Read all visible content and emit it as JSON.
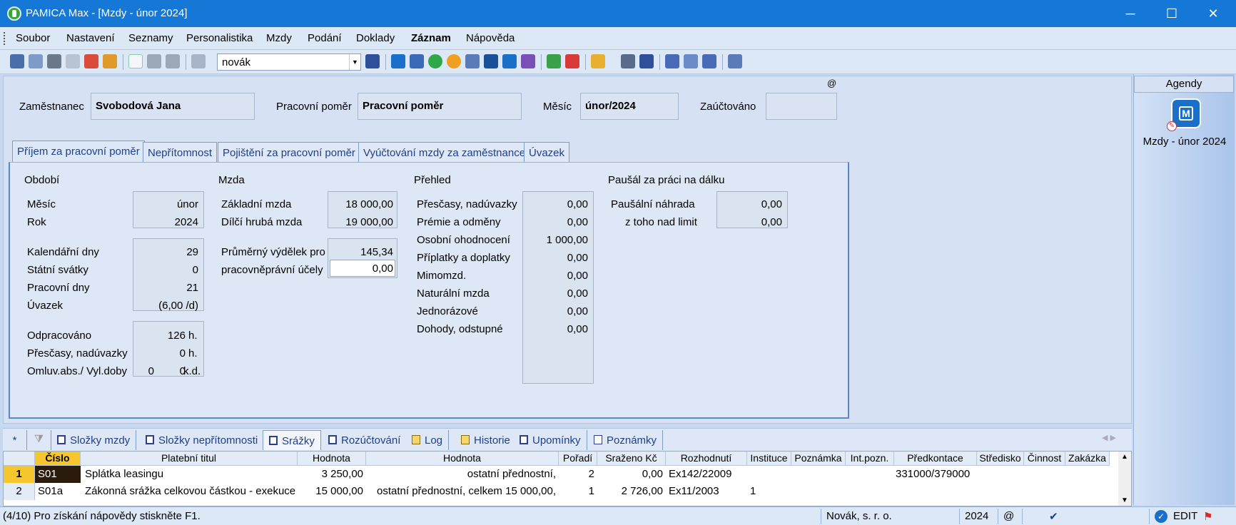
{
  "window": {
    "title": "PAMICA Max - [Mzdy - únor 2024]",
    "minimize": "─",
    "maximize": "☐",
    "close": "✕"
  },
  "menu": [
    {
      "label": "Soubor",
      "bold": false
    },
    {
      "label": "Nastavení",
      "bold": false
    },
    {
      "label": "Seznamy",
      "bold": false
    },
    {
      "label": "Personalistika",
      "bold": false
    },
    {
      "label": "Mzdy",
      "bold": false
    },
    {
      "label": "Podání",
      "bold": false
    },
    {
      "label": "Doklady",
      "bold": false
    },
    {
      "label": "Záznam",
      "bold": true
    },
    {
      "label": "Nápověda",
      "bold": false
    }
  ],
  "toolbar": {
    "search_value": "novák"
  },
  "header": {
    "at_label": "@",
    "employee_label": "Zaměstnanec",
    "employee_value": "Svobodová Jana",
    "relation_label": "Pracovní poměr",
    "relation_value": "Pracovní poměr",
    "month_label": "Měsíc",
    "month_value": "únor/2024",
    "posted_label": "Zaúčtováno",
    "posted_value": ""
  },
  "tabs": [
    "Příjem za pracovní poměr",
    "Nepřítomnost",
    "Pojištění za pracovní poměr",
    "Vyúčtování mzdy za zaměstnance",
    "Úvazek"
  ],
  "period": {
    "title": "Období",
    "month_label": "Měsíc",
    "month": "únor",
    "year_label": "Rok",
    "year": "2024",
    "cal_days_label": "Kalendářní dny",
    "cal_days": "29",
    "holidays_label": "Státní svátky",
    "holidays": "0",
    "work_days_label": "Pracovní dny",
    "work_days": "21",
    "workload_label": "Úvazek",
    "workload": "(6,00 /d)",
    "worked_label": "Odpracováno",
    "worked": "126",
    "worked_unit": "h.",
    "overtime_label": "Přesčasy, nadúvazky",
    "overtime": "0",
    "overtime_unit": "h.",
    "absence_label": "Omluv.abs./ Vyl.doby",
    "absence_a": "0",
    "absence_b": "0",
    "absence_unit": "k.d."
  },
  "wage": {
    "title": "Mzda",
    "base_label": "Základní mzda",
    "base": "18 000,00",
    "partial_label": "Dílčí hrubá mzda",
    "partial": "19 000,00",
    "avg_label1": "Průměrný výdělek pro",
    "avg": "145,34",
    "avg_label2": "pracovněprávní účely",
    "avg_input": "0,00"
  },
  "overview": {
    "title": "Přehled",
    "rows": [
      {
        "label": "Přesčasy, nadúvazky",
        "value": "0,00"
      },
      {
        "label": "Prémie a odměny",
        "value": "0,00"
      },
      {
        "label": "Osobní ohodnocení",
        "value": "1 000,00"
      },
      {
        "label": "Příplatky a doplatky",
        "value": "0,00"
      },
      {
        "label": "Mimomzd.",
        "value": "0,00"
      },
      {
        "label": "Naturální mzda",
        "value": "0,00"
      },
      {
        "label": "Jednorázové",
        "value": "0,00"
      },
      {
        "label": "Dohody, odstupné",
        "value": "0,00"
      }
    ]
  },
  "remote": {
    "title": "Paušál za práci na dálku",
    "comp_label": "Paušální náhrada",
    "comp": "0,00",
    "over_label": "z toho nad limit",
    "over": "0,00"
  },
  "sidebar": {
    "header": "Agendy",
    "item": "Mzdy - únor 2024",
    "icon_letter": "M"
  },
  "bottom_tabs": [
    {
      "label": "*",
      "icon": "none"
    },
    {
      "label": "",
      "icon": "filter"
    },
    {
      "label": "Složky mzdy",
      "icon": "list"
    },
    {
      "label": "Složky nepřítomnosti",
      "icon": "list"
    },
    {
      "label": "Srážky",
      "icon": "list"
    },
    {
      "label": "Rozúčtování",
      "icon": "list"
    },
    {
      "label": "Log",
      "icon": "doc"
    },
    {
      "label": "Historie",
      "icon": "doc"
    },
    {
      "label": "Upomínky",
      "icon": "list"
    },
    {
      "label": "Poznámky",
      "icon": "doc"
    }
  ],
  "grid": {
    "columns": [
      "Číslo",
      "Platební titul",
      "Hodnota",
      "Hodnota",
      "Pořadí",
      "Sraženo Kč",
      "Rozhodnutí",
      "Instituce",
      "Poznámka",
      "Int.pozn.",
      "Předkontace",
      "Středisko",
      "Činnost",
      "Zakázka"
    ],
    "rows": [
      {
        "n": "1",
        "cislo": "S01",
        "titul": "Splátka leasingu",
        "hodnota": "3 250,00",
        "hodnota2": "ostatní přednostní,",
        "poradi": "2",
        "srazeno": "0,00",
        "rozhodnuti": "Ex142/22009",
        "instituce": "",
        "predkontace": "331000/379000"
      },
      {
        "n": "2",
        "cislo": "S01a",
        "titul": "Zákonná srážka celkovou částkou - exekuce",
        "hodnota": "15 000,00",
        "hodnota2": "ostatní přednostní, celkem 15 000,00,",
        "poradi": "1",
        "srazeno": "2 726,00",
        "rozhodnuti": "Ex11/2003",
        "instituce": "1",
        "predkontace": ""
      }
    ]
  },
  "status": {
    "help": "(4/10) Pro získání nápovědy stiskněte F1.",
    "company": "Novák, s. r. o.",
    "year": "2024",
    "at": "@",
    "mode": "EDIT"
  },
  "colors": {
    "titlebar": "#1578d7",
    "tab_text": "#1f3f8a",
    "selected": "#f6c62e"
  }
}
